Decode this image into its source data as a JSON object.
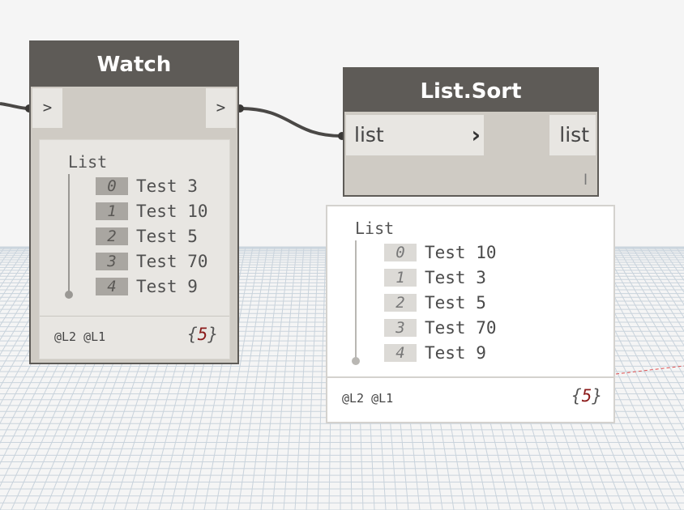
{
  "watch_node": {
    "title": "Watch",
    "input_port": ">",
    "output_port": ">",
    "preview": {
      "list_label": "List",
      "items": [
        {
          "index": "0",
          "value": "Test 3"
        },
        {
          "index": "1",
          "value": "Test 10"
        },
        {
          "index": "2",
          "value": "Test 5"
        },
        {
          "index": "3",
          "value": "Test 70"
        },
        {
          "index": "4",
          "value": "Test 9"
        }
      ],
      "levels": "@L2 @L1",
      "count_open": "{",
      "count": "5",
      "count_close": "}"
    }
  },
  "sort_node": {
    "title": "List.Sort",
    "input_port": "list",
    "output_port": "list",
    "lacing_glyph": "l",
    "preview": {
      "list_label": "List",
      "items": [
        {
          "index": "0",
          "value": "Test 10"
        },
        {
          "index": "1",
          "value": "Test 3"
        },
        {
          "index": "2",
          "value": "Test 5"
        },
        {
          "index": "3",
          "value": "Test 70"
        },
        {
          "index": "4",
          "value": "Test 9"
        }
      ],
      "levels": "@L2 @L1",
      "count_open": "{",
      "count": "5",
      "count_close": "}"
    }
  },
  "icons": {
    "chevron": "chevron-right-icon"
  },
  "colors": {
    "node_header": "#5e5b57",
    "node_body": "#cfcbc4",
    "port_bg": "#e8e6e2",
    "count_accent": "#8b1a1a",
    "grid_line": "#c9d3dc"
  }
}
